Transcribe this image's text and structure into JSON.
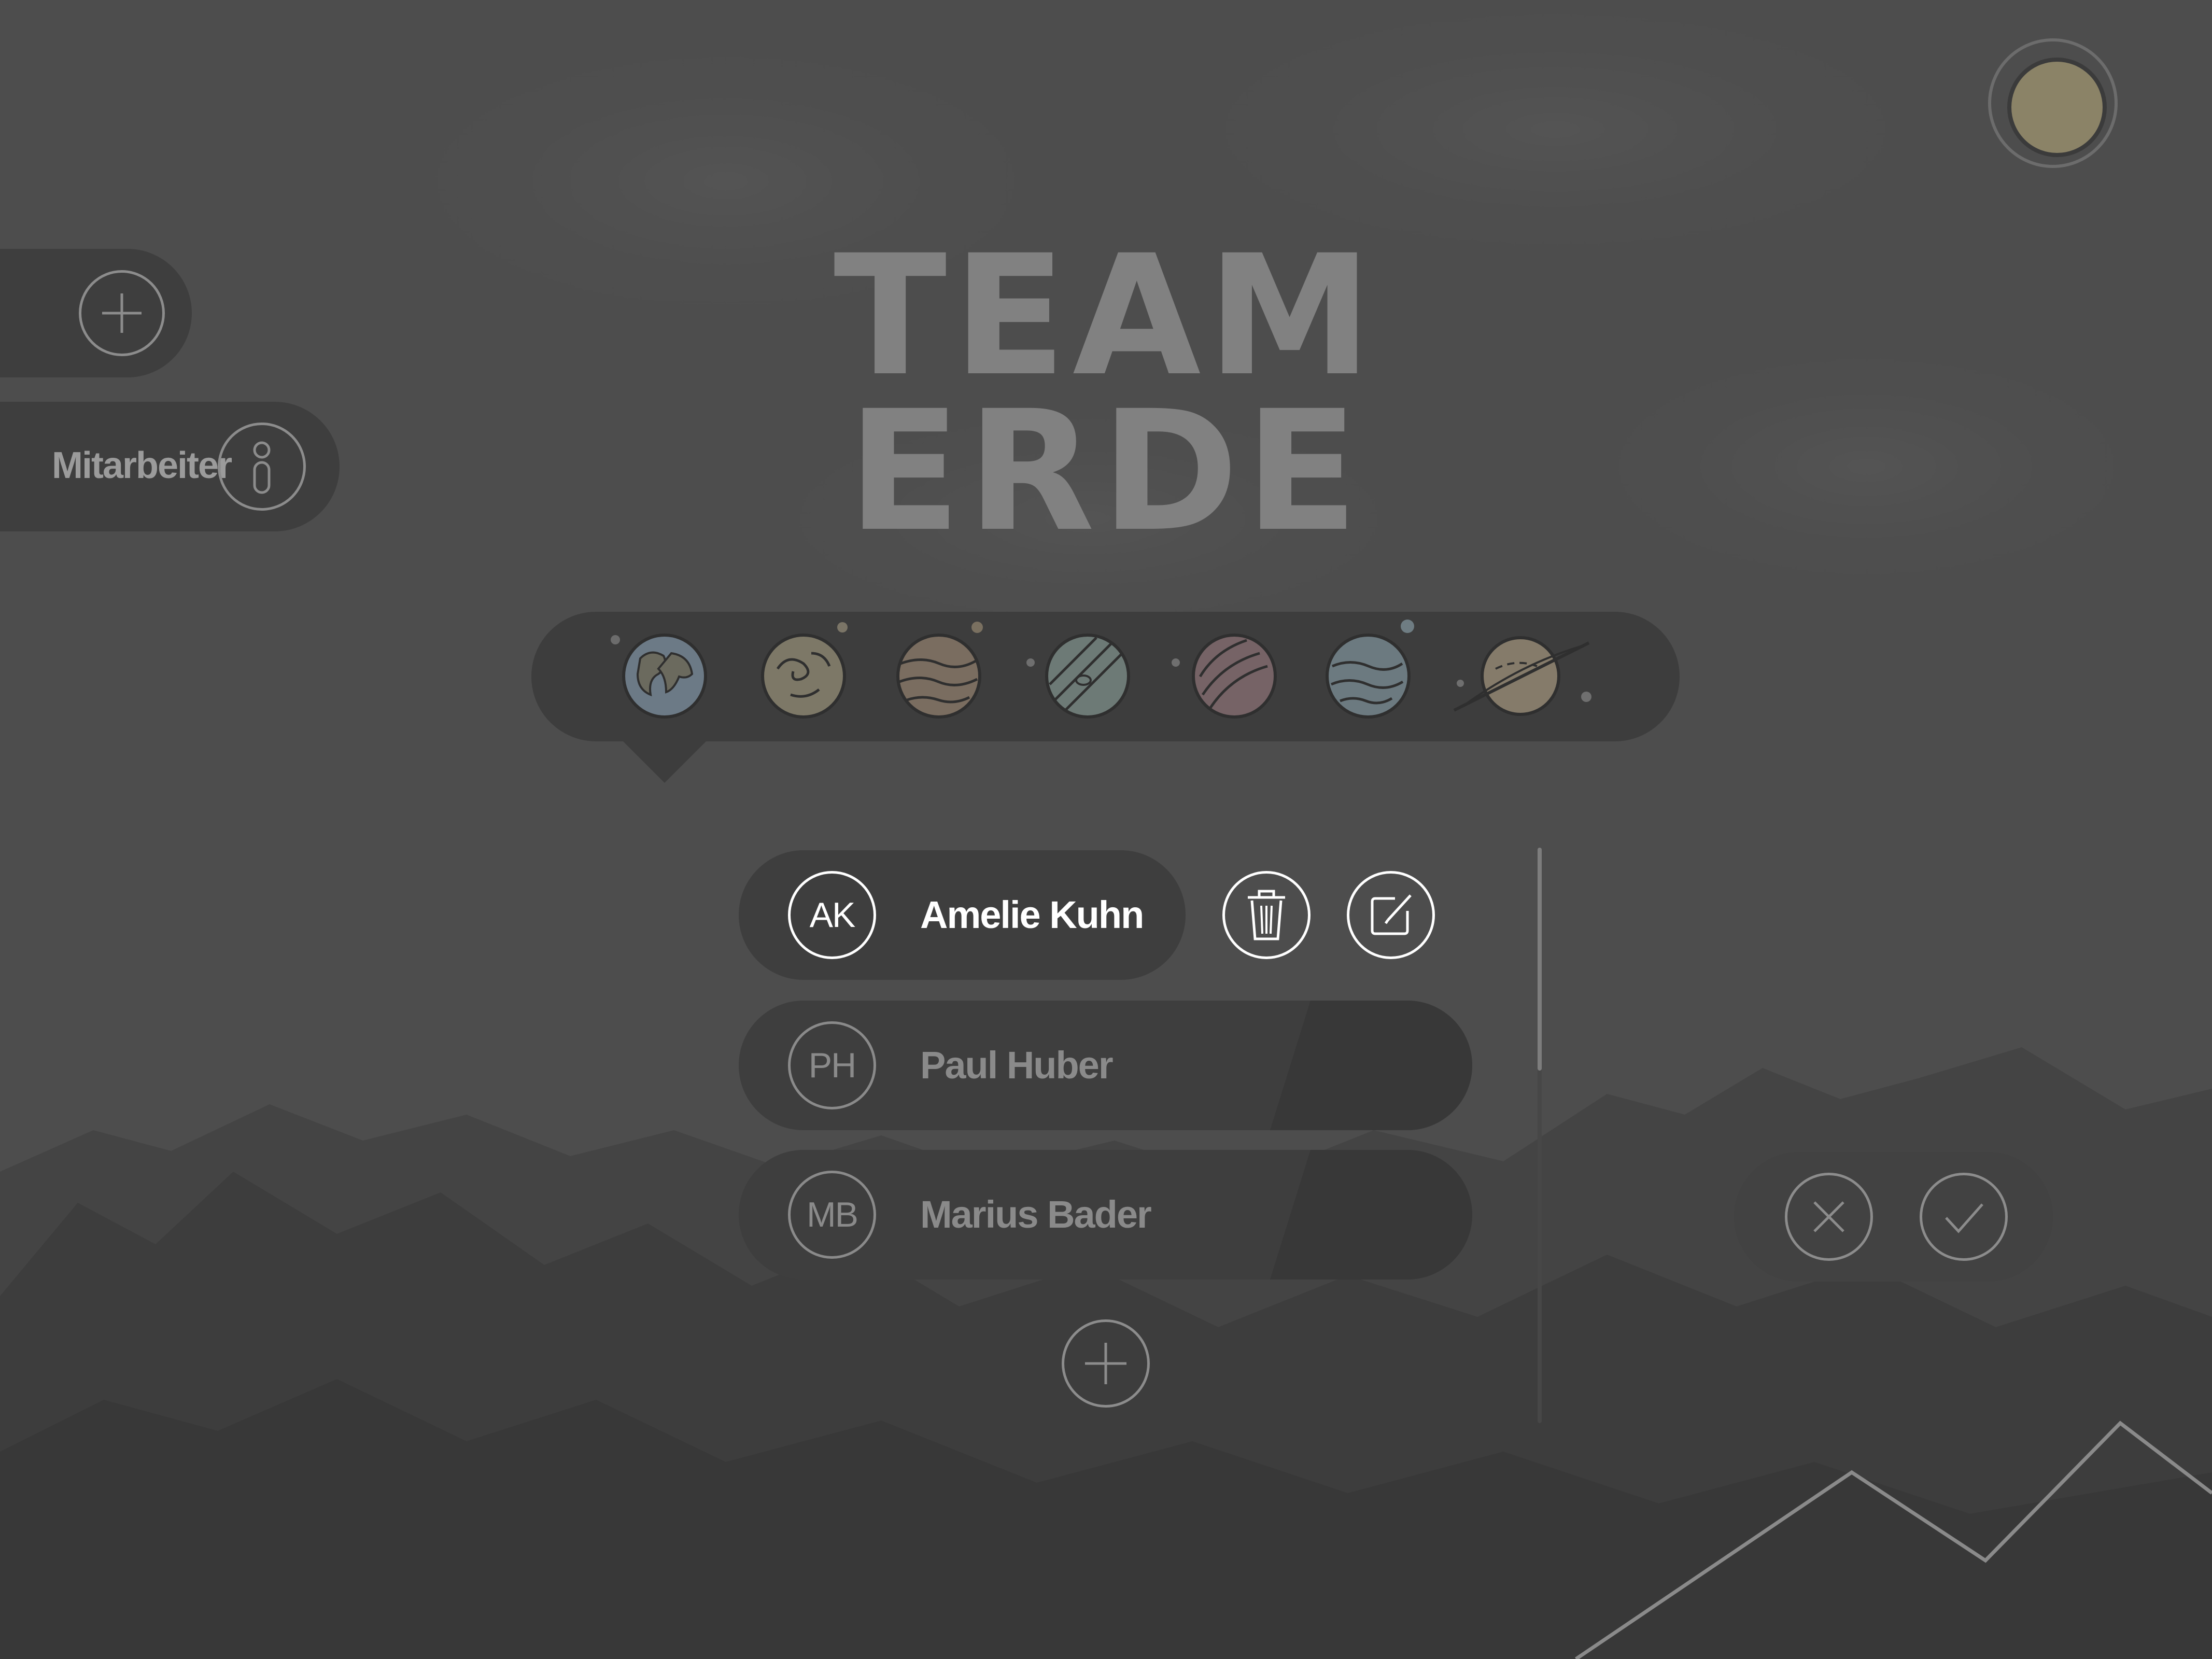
{
  "header": {
    "title_line1": "TEAM",
    "title_line2": "ERDE"
  },
  "sidebar": {
    "add_icon": "plus-icon",
    "info_label": "Mitarbeiter",
    "info_icon": "info-icon"
  },
  "planets": {
    "items": [
      "earth-icon",
      "swirl-planet-icon",
      "striped-planet-icon",
      "banded-planet-icon",
      "red-planet-icon",
      "ice-planet-icon",
      "ringed-planet-icon"
    ],
    "selected": "earth-icon"
  },
  "members": [
    {
      "initials": "AK",
      "name": "Amelie Kuhn",
      "active": true
    },
    {
      "initials": "PH",
      "name": "Paul Huber",
      "active": false
    },
    {
      "initials": "MB",
      "name": "Marius Bader",
      "active": false
    }
  ],
  "actions": {
    "delete_icon": "trash-icon",
    "edit_icon": "edit-icon",
    "add_member_icon": "plus-icon",
    "cancel_icon": "close-icon",
    "confirm_icon": "check-icon"
  },
  "colors": {
    "background": "#4d4d4d",
    "panel": "#3e3e3e",
    "avatar": "#8b8367",
    "active_text": "#ffffff",
    "muted_text": "#8a8a8a"
  }
}
